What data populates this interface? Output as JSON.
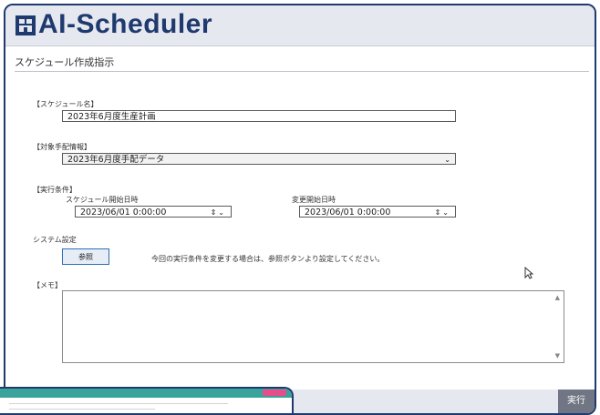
{
  "app": {
    "title": "AI-Scheduler",
    "logo_icon": "building-logo-icon"
  },
  "page": {
    "title": "スケジュール作成指示"
  },
  "schedule_name": {
    "label": "【スケジュール名】",
    "value": "2023年6月度生産計画"
  },
  "target_info": {
    "label": "【対象手配情報】",
    "selected": "2023年6月度手配データ"
  },
  "conditions": {
    "label": "【実行条件】",
    "start_label": "スケジュール開始日時",
    "start_value": "2023/06/01 0:00:00",
    "change_label": "変更開始日時",
    "change_value": "2023/06/01 0:00:00"
  },
  "system": {
    "label": "システム設定",
    "button": "参照",
    "hint": "今回の実行条件を変更する場合は、参照ボタンより設定してください。"
  },
  "memo": {
    "label": "【メモ】",
    "value": ""
  },
  "footer": {
    "run_button": "実行"
  },
  "colors": {
    "brand": "#1e3a6e",
    "run_button": "#707683",
    "thumbnail_bar": "#3aa39b",
    "badge": "#e84c8a"
  }
}
